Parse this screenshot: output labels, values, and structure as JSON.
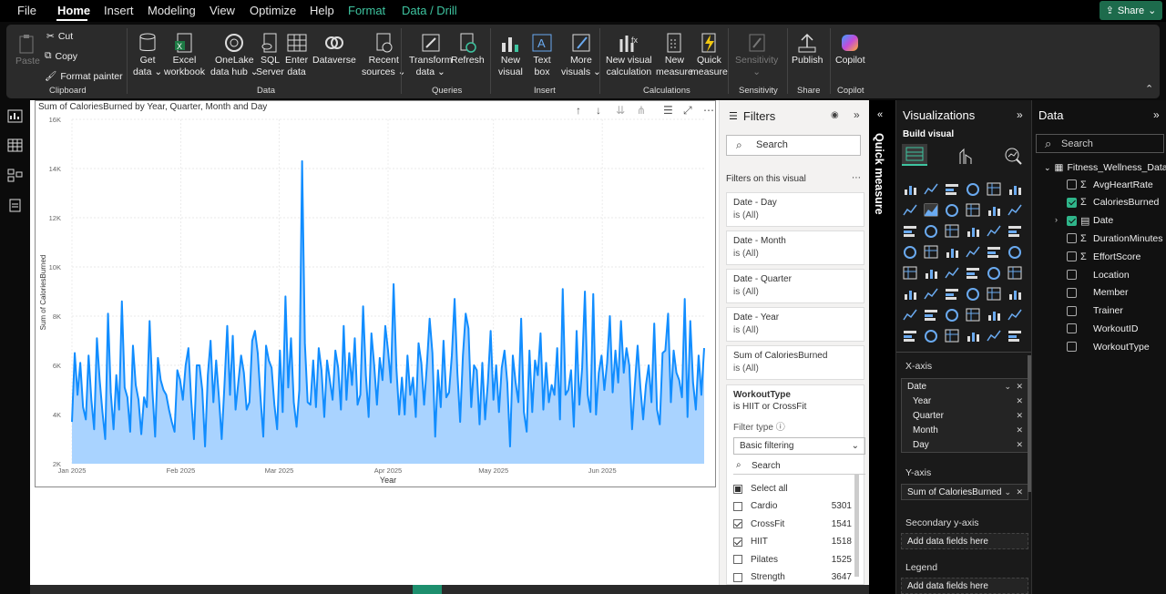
{
  "menu": {
    "file": "File",
    "home": "Home",
    "insert": "Insert",
    "modeling": "Modeling",
    "view": "View",
    "optimize": "Optimize",
    "help": "Help",
    "format": "Format",
    "data_drill": "Data / Drill",
    "share": "Share"
  },
  "ribbon": {
    "paste": "Paste",
    "cut": "Cut",
    "copy": "Copy",
    "format_painter": "Format painter",
    "group_clipboard": "Clipboard",
    "get_data": "Get",
    "get_data2": "data",
    "excel": "Excel",
    "excel2": "workbook",
    "onelake": "OneLake",
    "onelake2": "data hub",
    "sql": "SQL",
    "sql2": "Server",
    "enter": "Enter",
    "enter2": "data",
    "dataverse": "Dataverse",
    "recent": "Recent",
    "recent2": "sources",
    "group_data": "Data",
    "transform": "Transform",
    "transform2": "data",
    "refresh": "Refresh",
    "group_queries": "Queries",
    "new_visual": "New",
    "new_visual2": "visual",
    "text_box": "Text",
    "text_box2": "box",
    "more_visuals": "More",
    "more_visuals2": "visuals",
    "group_insert": "Insert",
    "new_visual_calc": "New visual",
    "new_visual_calc2": "calculation",
    "new_measure": "New",
    "new_measure2": "measure",
    "quick_measure": "Quick",
    "quick_measure2": "measure",
    "group_calculations": "Calculations",
    "sensitivity": "Sensitivity",
    "group_sensitivity": "Sensitivity",
    "publish": "Publish",
    "group_share": "Share",
    "copilot": "Copilot",
    "group_copilot": "Copilot"
  },
  "chart_data": {
    "type": "area",
    "title": "Sum of CaloriesBurned by Year, Quarter, Month and Day",
    "xlabel": "Year",
    "ylabel": "Sum of CaloriesBurned",
    "ylim": [
      2000,
      16000
    ],
    "yticks": [
      "2K",
      "4K",
      "6K",
      "8K",
      "10K",
      "12K",
      "14K",
      "16K"
    ],
    "xticks": [
      {
        "label": "Jan 2025",
        "day": 0
      },
      {
        "label": "Feb 2025",
        "day": 31
      },
      {
        "label": "Mar 2025",
        "day": 59
      },
      {
        "label": "Apr 2025",
        "day": 90
      },
      {
        "label": "May 2025",
        "day": 120
      },
      {
        "label": "Jun 2025",
        "day": 151
      }
    ],
    "x_range_days": [
      0,
      180
    ],
    "values": [
      3700,
      6500,
      4800,
      6100,
      4300,
      3800,
      6400,
      4600,
      3400,
      7100,
      5400,
      4100,
      3000,
      8100,
      4900,
      3400,
      5600,
      4200,
      8600,
      5100,
      4700,
      3300,
      6800,
      5200,
      4600,
      3200,
      4700,
      4300,
      7800,
      5000,
      3100,
      6300,
      5400,
      5000,
      4800,
      4200,
      3700,
      3300,
      5800,
      5400,
      4600,
      6000,
      6700,
      4600,
      3000,
      6000,
      6000,
      5000,
      2700,
      5600,
      7000,
      4500,
      6200,
      4700,
      3000,
      5200,
      7600,
      4800,
      7200,
      4200,
      5300,
      6400,
      5700,
      4200,
      4500,
      7000,
      7400,
      6500,
      4700,
      3100,
      6800,
      6200,
      5900,
      4400,
      3400,
      6600,
      4100,
      8800,
      5100,
      7100,
      4500,
      3500,
      5000,
      14300,
      6900,
      4500,
      4400,
      6200,
      4300,
      6700,
      5800,
      3900,
      6200,
      5400,
      4600,
      6600,
      5900,
      4200,
      7600,
      4600,
      6500,
      5200,
      7100,
      4400,
      4800,
      8400,
      5600,
      3900,
      7300,
      6000,
      4400,
      6300,
      5400,
      7600,
      6600,
      5300,
      9300,
      5900,
      4000,
      5500,
      4000,
      6400,
      4800,
      5500,
      3900,
      6900,
      6100,
      4400,
      6000,
      7900,
      6500,
      3100,
      5800,
      4300,
      7000,
      4700,
      4900,
      6400,
      8700,
      5700,
      3700,
      6400,
      8100,
      7500,
      4300,
      6000,
      5800,
      3600,
      6100,
      3800,
      5300,
      7400,
      4600,
      6000,
      4100,
      5900,
      6600,
      5300,
      2700,
      6400,
      5300,
      4500,
      7900,
      4100,
      3300,
      6600,
      4100,
      6200,
      5600,
      7300,
      4200,
      6100,
      4500,
      5200,
      4800,
      6700,
      3800,
      9100,
      4800,
      5000,
      5800,
      3500,
      7400,
      4400,
      5900,
      9000,
      4800,
      4100,
      8900,
      4000,
      5700,
      6400,
      5000,
      6100,
      8000,
      4900,
      6600,
      5300,
      7800,
      5700,
      6700,
      6000,
      3400,
      5200,
      6800,
      5100,
      3800,
      5200,
      6000,
      4500,
      7700,
      4200,
      3600,
      6500,
      6600,
      8100,
      4500,
      6600,
      5700,
      5400,
      4700,
      8700,
      3900,
      7800,
      5300,
      4200,
      6400,
      4800,
      6700
    ]
  },
  "filters": {
    "title": "Filters",
    "search_placeholder": "Search",
    "on_visual": "Filters on this visual",
    "cards": [
      {
        "name": "Date - Day",
        "value": "is (All)"
      },
      {
        "name": "Date - Month",
        "value": "is (All)"
      },
      {
        "name": "Date - Quarter",
        "value": "is (All)"
      },
      {
        "name": "Date - Year",
        "value": "is (All)"
      },
      {
        "name": "Sum of CaloriesBurned",
        "value": "is (All)"
      }
    ],
    "workout": {
      "name": "WorkoutType",
      "value": "is HIIT or CrossFit",
      "filter_type": "Filter type",
      "filter_type_value": "Basic filtering",
      "search": "Search",
      "select_all": "Select all",
      "options": [
        {
          "label": "Cardio",
          "count": "5301",
          "checked": false
        },
        {
          "label": "CrossFit",
          "count": "1541",
          "checked": true
        },
        {
          "label": "HIIT",
          "count": "1518",
          "checked": true
        },
        {
          "label": "Pilates",
          "count": "1525",
          "checked": false
        },
        {
          "label": "Strength",
          "count": "3647",
          "checked": false
        }
      ]
    }
  },
  "quick_measure": "Quick measure",
  "viz": {
    "title": "Visualizations",
    "build": "Build visual",
    "more": "...",
    "xaxis": "X-axis",
    "yaxis": "Y-axis",
    "secondary": "Secondary y-axis",
    "legend": "Legend",
    "add_fields": "Add data fields here",
    "x_fields": [
      "Date",
      "Year",
      "Quarter",
      "Month",
      "Day"
    ],
    "y_field": "Sum of CaloriesBurned"
  },
  "data": {
    "title": "Data",
    "search": "Search",
    "table": "Fitness_Wellness_Data",
    "fields": [
      {
        "name": "AvgHeartRate",
        "sigma": true,
        "checked": false
      },
      {
        "name": "CaloriesBurned",
        "sigma": true,
        "checked": true
      },
      {
        "name": "Date",
        "sigma": false,
        "checked": true,
        "date": true
      },
      {
        "name": "DurationMinutes",
        "sigma": true,
        "checked": false
      },
      {
        "name": "EffortScore",
        "sigma": true,
        "checked": false
      },
      {
        "name": "Location",
        "sigma": false,
        "checked": false
      },
      {
        "name": "Member",
        "sigma": false,
        "checked": false
      },
      {
        "name": "Trainer",
        "sigma": false,
        "checked": false
      },
      {
        "name": "WorkoutID",
        "sigma": false,
        "checked": false
      },
      {
        "name": "WorkoutType",
        "sigma": false,
        "checked": false
      }
    ]
  },
  "colors": {
    "line": "#118dff",
    "area": "#a9d3ff",
    "accent": "#3ec4a0"
  }
}
